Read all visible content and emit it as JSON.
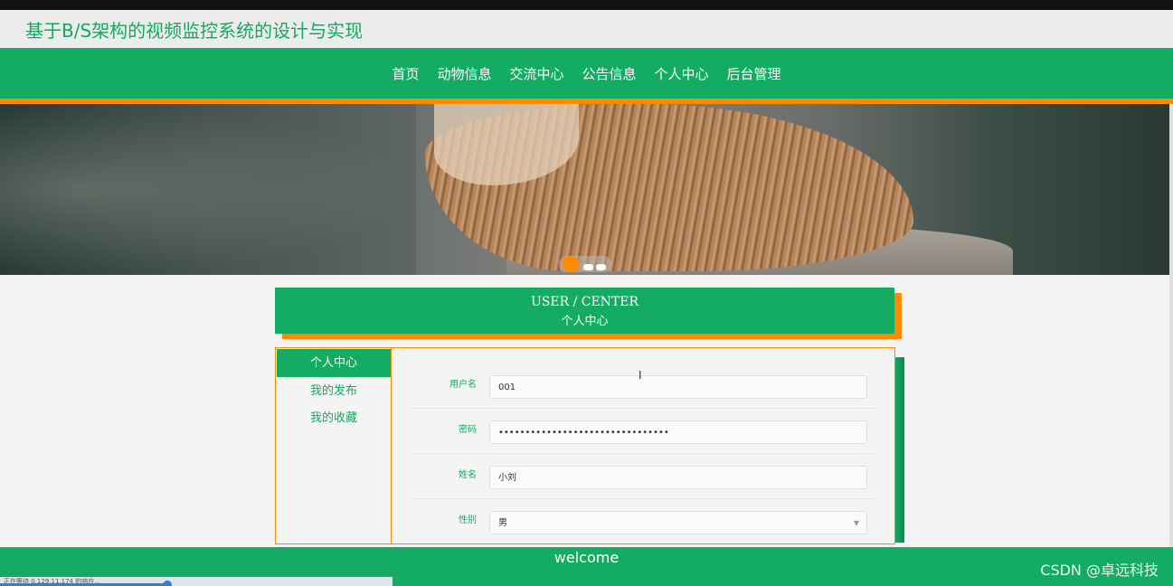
{
  "header": {
    "site_title": "基于B/S架构的视频监控系统的设计与实现"
  },
  "nav": {
    "items": [
      {
        "label": "首页"
      },
      {
        "label": "动物信息"
      },
      {
        "label": "交流中心"
      },
      {
        "label": "公告信息"
      },
      {
        "label": "个人中心"
      },
      {
        "label": "后台管理"
      }
    ]
  },
  "colors": {
    "brand_green": "#13ac62",
    "accent_orange": "#ff8a00"
  },
  "user_center": {
    "title_en": "USER / CENTER",
    "title_cn": "个人中心"
  },
  "sidebar": {
    "items": [
      {
        "label": "个人中心",
        "active": true
      },
      {
        "label": "我的发布",
        "active": false
      },
      {
        "label": "我的收藏",
        "active": false
      }
    ]
  },
  "form": {
    "username": {
      "label": "用户名",
      "value": "001"
    },
    "password": {
      "label": "密码",
      "value": "••••••••••••••••••••••••••••••••"
    },
    "name": {
      "label": "姓名",
      "value": "小刘"
    },
    "gender": {
      "label": "性别",
      "value": "男"
    }
  },
  "footer": {
    "welcome": "welcome",
    "watermark": "CSDN @卓远科技"
  },
  "status_bar": {
    "text": "正在等待 0.129.11.174 的响应..."
  }
}
